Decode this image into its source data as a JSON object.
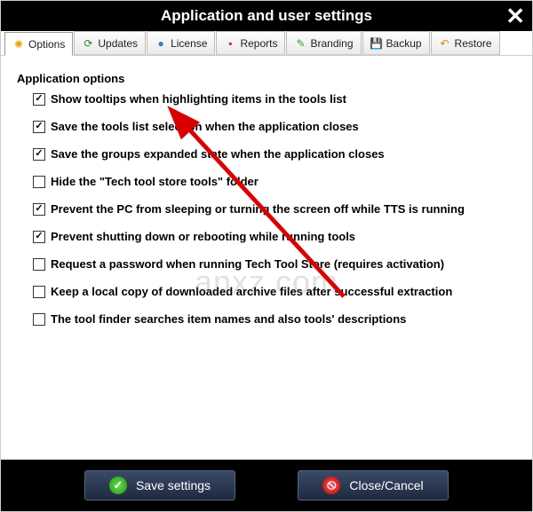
{
  "window": {
    "title": "Application and user settings"
  },
  "tabs": [
    {
      "label": "Options",
      "icon": "gear-icon",
      "active": true
    },
    {
      "label": "Updates",
      "icon": "update-icon",
      "active": false
    },
    {
      "label": "License",
      "icon": "license-icon",
      "active": false
    },
    {
      "label": "Reports",
      "icon": "reports-icon",
      "active": false
    },
    {
      "label": "Branding",
      "icon": "branding-icon",
      "active": false
    },
    {
      "label": "Backup",
      "icon": "backup-icon",
      "active": false
    },
    {
      "label": "Restore",
      "icon": "restore-icon",
      "active": false
    }
  ],
  "section": {
    "heading": "Application options"
  },
  "options": [
    {
      "checked": true,
      "label": "Show tooltips when highlighting items in the tools list"
    },
    {
      "checked": true,
      "label": "Save the tools list selection when the application closes"
    },
    {
      "checked": true,
      "label": "Save the groups expanded state when the application closes"
    },
    {
      "checked": false,
      "label": "Hide the \"Tech tool store tools\" folder"
    },
    {
      "checked": true,
      "label": "Prevent the PC from sleeping or turning the screen off while TTS is running"
    },
    {
      "checked": true,
      "label": "Prevent shutting down or rebooting while running tools"
    },
    {
      "checked": false,
      "label": "Request a password when running Tech Tool Store (requires activation)"
    },
    {
      "checked": false,
      "label": "Keep a local copy of downloaded archive files after successful extraction"
    },
    {
      "checked": false,
      "label": "The tool finder searches item names and also tools' descriptions"
    }
  ],
  "buttons": {
    "save": "Save settings",
    "cancel": "Close/Cancel"
  },
  "watermark": "anxz.com"
}
